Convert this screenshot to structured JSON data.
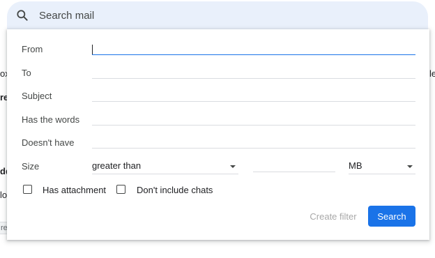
{
  "search": {
    "placeholder": "Search mail",
    "icon": "search-icon"
  },
  "background": {
    "fragments": [
      "ox",
      "re",
      "dd",
      "lo",
      "re",
      "le"
    ]
  },
  "filter": {
    "from_label": "From",
    "from_value": "",
    "to_label": "To",
    "to_value": "",
    "subject_label": "Subject",
    "subject_value": "",
    "has_words_label": "Has the words",
    "has_words_value": "",
    "doesnt_have_label": "Doesn't have",
    "doesnt_have_value": "",
    "size_label": "Size",
    "size_operator": "greater than",
    "size_value": "",
    "size_unit": "MB",
    "has_attachment_label": "Has attachment",
    "has_attachment_checked": false,
    "no_chats_label": "Don't include chats",
    "no_chats_checked": false,
    "create_filter_label": "Create filter",
    "search_button_label": "Search"
  },
  "colors": {
    "accent": "#1a73e8",
    "searchbar_bg": "#e9f0fb",
    "disabled_text": "#a8a8a8"
  }
}
